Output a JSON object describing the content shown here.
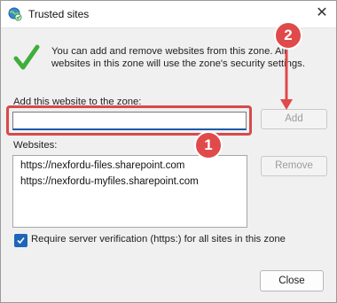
{
  "window": {
    "title": "Trusted sites",
    "close_glyph": "✕"
  },
  "info": {
    "message": "You can add and remove websites from this zone. All websites in this zone will use the zone's security settings."
  },
  "add_section": {
    "label": "Add this website to the zone:",
    "input_value": "",
    "add_label": "Add"
  },
  "websites": {
    "label": "Websites:",
    "items": [
      "https://nexfordu-files.sharepoint.com",
      "https://nexfordu-myfiles.sharepoint.com"
    ],
    "remove_label": "Remove"
  },
  "verification": {
    "checked": true,
    "label": "Require server verification (https:) for all sites in this zone"
  },
  "footer": {
    "close_label": "Close"
  },
  "annotations": {
    "badge_1": "1",
    "badge_2": "2",
    "color": "#e04a4a"
  },
  "icons": [
    "globe-check-icon",
    "green-check-icon",
    "close-icon",
    "checkbox-check-icon"
  ]
}
